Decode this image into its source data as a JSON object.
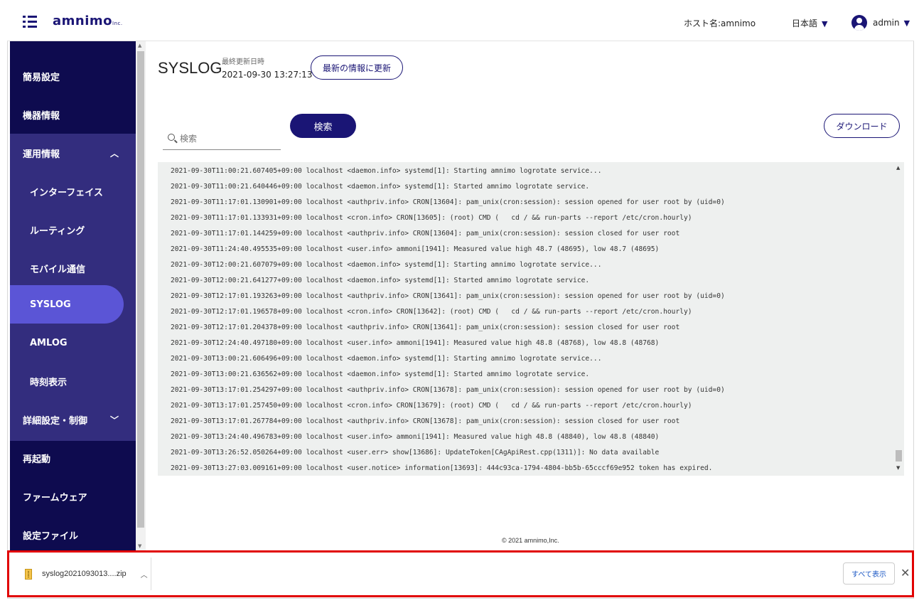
{
  "header": {
    "logo_text": "amnimo",
    "logo_suffix": "Inc.",
    "hostname": "ホスト名:amnimo",
    "language": "日本語",
    "user": "admin"
  },
  "sidebar": {
    "items": [
      {
        "label": "簡易設定"
      },
      {
        "label": "機器情報"
      },
      {
        "label": "運用情報"
      },
      {
        "label": "インターフェイス"
      },
      {
        "label": "ルーティング"
      },
      {
        "label": "モバイル通信"
      },
      {
        "label": "SYSLOG"
      },
      {
        "label": "AMLOG"
      },
      {
        "label": "時刻表示"
      },
      {
        "label": "詳細設定・制御"
      },
      {
        "label": "再起動"
      },
      {
        "label": "ファームウェア"
      },
      {
        "label": "設定ファイル"
      }
    ]
  },
  "main": {
    "title": "SYSLOG",
    "updated_label": "最終更新日時",
    "updated_value": "2021-09-30 13:27:13",
    "refresh_label": "最新の情報に更新",
    "search_placeholder": "検索",
    "search_button": "検索",
    "download_button": "ダウンロード",
    "log_lines": [
      "2021-09-30T11:00:21.607405+09:00 localhost <daemon.info> systemd[1]: Starting amnimo logrotate service...",
      "2021-09-30T11:00:21.640446+09:00 localhost <daemon.info> systemd[1]: Started amnimo logrotate service.",
      "2021-09-30T11:17:01.130901+09:00 localhost <authpriv.info> CRON[13604]: pam_unix(cron:session): session opened for user root by (uid=0)",
      "2021-09-30T11:17:01.133931+09:00 localhost <cron.info> CRON[13605]: (root) CMD (   cd / && run-parts --report /etc/cron.hourly)",
      "2021-09-30T11:17:01.144259+09:00 localhost <authpriv.info> CRON[13604]: pam_unix(cron:session): session closed for user root",
      "2021-09-30T11:24:40.495535+09:00 localhost <user.info> ammoni[1941]: Measured value high 48.7 (48695), low 48.7 (48695)",
      "2021-09-30T12:00:21.607079+09:00 localhost <daemon.info> systemd[1]: Starting amnimo logrotate service...",
      "2021-09-30T12:00:21.641277+09:00 localhost <daemon.info> systemd[1]: Started amnimo logrotate service.",
      "2021-09-30T12:17:01.193263+09:00 localhost <authpriv.info> CRON[13641]: pam_unix(cron:session): session opened for user root by (uid=0)",
      "2021-09-30T12:17:01.196578+09:00 localhost <cron.info> CRON[13642]: (root) CMD (   cd / && run-parts --report /etc/cron.hourly)",
      "2021-09-30T12:17:01.204378+09:00 localhost <authpriv.info> CRON[13641]: pam_unix(cron:session): session closed for user root",
      "2021-09-30T12:24:40.497180+09:00 localhost <user.info> ammoni[1941]: Measured value high 48.8 (48768), low 48.8 (48768)",
      "2021-09-30T13:00:21.606496+09:00 localhost <daemon.info> systemd[1]: Starting amnimo logrotate service...",
      "2021-09-30T13:00:21.636562+09:00 localhost <daemon.info> systemd[1]: Started amnimo logrotate service.",
      "2021-09-30T13:17:01.254297+09:00 localhost <authpriv.info> CRON[13678]: pam_unix(cron:session): session opened for user root by (uid=0)",
      "2021-09-30T13:17:01.257450+09:00 localhost <cron.info> CRON[13679]: (root) CMD (   cd / && run-parts --report /etc/cron.hourly)",
      "2021-09-30T13:17:01.267784+09:00 localhost <authpriv.info> CRON[13678]: pam_unix(cron:session): session closed for user root",
      "2021-09-30T13:24:40.496783+09:00 localhost <user.info> ammoni[1941]: Measured value high 48.8 (48840), low 48.8 (48840)",
      "2021-09-30T13:26:52.050264+09:00 localhost <user.err> show[13686]: UpdateToken[CAgApiRest.cpp(1311)]: No data available",
      "2021-09-30T13:27:03.009161+09:00 localhost <user.notice> information[13693]: 444c93ca-1794-4804-bb5b-65cccf69e952 token has expired."
    ],
    "footer": "© 2021 amnimo,Inc."
  },
  "download_bar": {
    "file_name": "syslog2021093013....zip",
    "show_all": "すべて表示"
  },
  "colors": {
    "brand": "#1a1575",
    "sidebar_bg": "#0e0b4f",
    "sidebar_sub_bg": "#332d7e",
    "sidebar_active": "#5b55d6",
    "highlight_border": "#e10000"
  },
  "icons": [
    "menu-icon",
    "search-icon",
    "user-icon",
    "chevron-up-icon",
    "chevron-down-icon",
    "zip-file-icon",
    "close-icon"
  ]
}
